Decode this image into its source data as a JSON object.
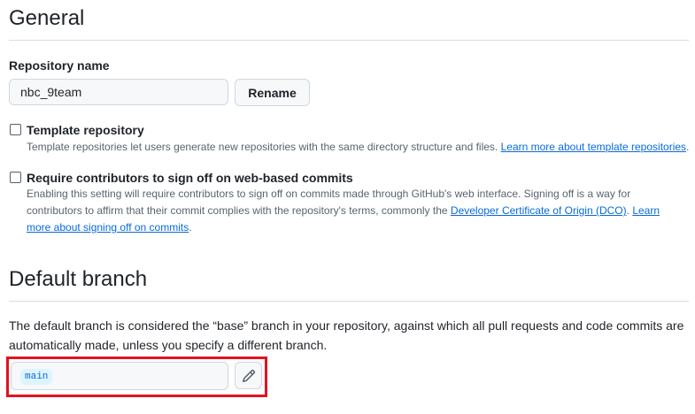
{
  "general": {
    "title": "General",
    "repo_name_label": "Repository name",
    "repo_name_value": "nbc_9team",
    "rename_button": "Rename"
  },
  "template_repo": {
    "label": "Template repository",
    "description": "Template repositories let users generate new repositories with the same directory structure and files. ",
    "link": "Learn more about template repositories",
    "end": ".",
    "checked": false
  },
  "signoff": {
    "label": "Require contributors to sign off on web-based commits",
    "description_line1": "Enabling this setting will require contributors to sign off on commits made through GitHub's web interface. Signing off is a way for",
    "description_line2": "contributors to affirm that their commit complies with the repository's terms, commonly the ",
    "dco_link": "Developer Certificate of Origin (DCO)",
    "sep": ". ",
    "learn_link_part1": "Learn",
    "learn_link_part2": "more about signing off on commits",
    "end": ".",
    "checked": false
  },
  "default_branch": {
    "title": "Default branch",
    "description_line1": "The default branch is considered the “base” branch in your repository, against which all pull requests and code commits are",
    "description_line2": "automatically made, unless you specify a different branch.",
    "branch_name": "main",
    "edit_icon": "pencil-icon"
  },
  "colors": {
    "link": "#0969da",
    "highlight": "#e3121f",
    "branch_pill_bg": "#ddf4ff"
  }
}
